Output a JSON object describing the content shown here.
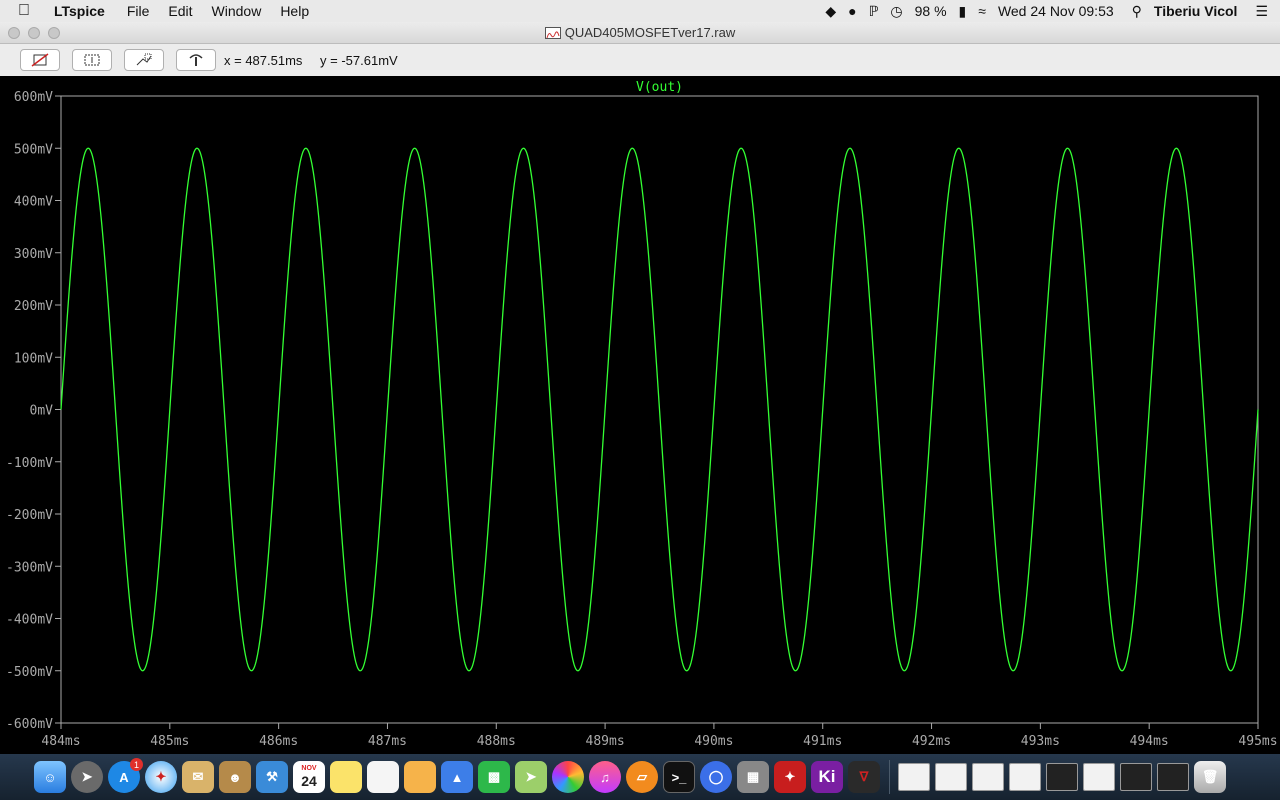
{
  "menubar": {
    "app_name": "LTspice",
    "menus": [
      "File",
      "Edit",
      "Window",
      "Help"
    ],
    "battery": "98 %",
    "clock": "Wed 24 Nov  09:53",
    "user": "Tiberiu Vicol"
  },
  "window": {
    "title": "QUAD405MOSFETver17.raw"
  },
  "toolbar": {
    "cursor_x": "x = 487.51ms",
    "cursor_y": "y = -57.61mV"
  },
  "chart_data": {
    "type": "line",
    "title": "V(out)",
    "xlabel": "",
    "ylabel": "",
    "xlim": [
      484,
      495
    ],
    "ylim": [
      -600,
      600
    ],
    "x_unit": "ms",
    "y_unit": "mV",
    "x_ticks": [
      "484ms",
      "485ms",
      "486ms",
      "487ms",
      "488ms",
      "489ms",
      "490ms",
      "491ms",
      "492ms",
      "493ms",
      "494ms",
      "495ms"
    ],
    "y_ticks": [
      "600mV",
      "500mV",
      "400mV",
      "300mV",
      "200mV",
      "100mV",
      "0mV",
      "-100mV",
      "-200mV",
      "-300mV",
      "-400mV",
      "-500mV",
      "-600mV"
    ],
    "series": [
      {
        "name": "V(out)",
        "color": "#33ff33",
        "waveform": "sine",
        "amplitude": 500,
        "frequency_khz": 1,
        "x_start": 484,
        "x_end": 495,
        "y_at_start": 0
      }
    ],
    "grid": false,
    "background": "#000000",
    "axis_color": "#aaaaaa"
  },
  "dock": {
    "badge_count": "1",
    "calendar_month": "NOV",
    "calendar_day": "24",
    "kicad_label": "Ki"
  }
}
